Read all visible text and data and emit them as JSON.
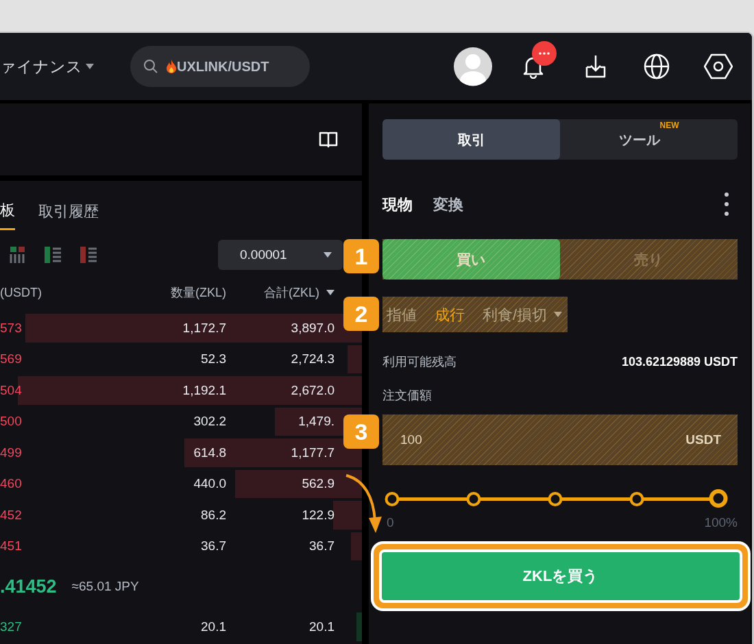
{
  "header": {
    "menu_label": "ァイナンス",
    "search": {
      "value": "UXLINK/USDT"
    }
  },
  "orderbook": {
    "tabs": [
      {
        "label": "板",
        "selected": true
      },
      {
        "label": "取引履歴",
        "selected": false
      }
    ],
    "precision": "0.00001",
    "columns": [
      "(USDT)",
      "数量(ZKL)",
      "合計(ZKL)"
    ],
    "asks": [
      {
        "price": "573",
        "amount": "1,172.7",
        "total": "3,897.0",
        "level": 0.93
      },
      {
        "price": "569",
        "amount": "52.3",
        "total": "2,724.3",
        "level": 0.04
      },
      {
        "price": "504",
        "amount": "1,192.1",
        "total": "2,672.0",
        "level": 0.95
      },
      {
        "price": "500",
        "amount": "302.2",
        "total": "1,479.",
        "level": 0.24
      },
      {
        "price": "499",
        "amount": "614.8",
        "total": "1,177.7",
        "level": 0.49
      },
      {
        "price": "460",
        "amount": "440.0",
        "total": "562.9",
        "level": 0.35
      },
      {
        "price": "452",
        "amount": "86.2",
        "total": "122.9",
        "level": 0.08
      },
      {
        "price": "451",
        "amount": "36.7",
        "total": "36.7",
        "level": 0.03
      }
    ],
    "last_price": ".41452",
    "fiat": "≈65.01 JPY",
    "bids": [
      {
        "price": "327",
        "amount": "20.1",
        "total": "20.1",
        "level": 0.015
      }
    ]
  },
  "trade": {
    "tabs": [
      {
        "label": "取引",
        "selected": true
      },
      {
        "label": "ツール",
        "badge": "NEW",
        "selected": false
      }
    ],
    "modes": [
      {
        "label": "現物",
        "selected": true
      },
      {
        "label": "変換",
        "selected": false
      }
    ],
    "side": {
      "annotation": "1",
      "options": [
        {
          "label": "買い",
          "selected": true
        },
        {
          "label": "売り",
          "selected": false
        }
      ]
    },
    "order_types": {
      "annotation": "2",
      "options": [
        {
          "label": "指値",
          "selected": false,
          "dropdown": false
        },
        {
          "label": "成行",
          "selected": true,
          "dropdown": false
        },
        {
          "label": "利食/損切",
          "selected": false,
          "dropdown": true
        }
      ]
    },
    "balance": {
      "label": "利用可能残高",
      "value": "103.62129889 USDT"
    },
    "amount": {
      "label": "注文価額",
      "value": "100",
      "unit": "USDT",
      "annotation": "3"
    },
    "slider": {
      "level": 1,
      "min_label": "0",
      "max_label": "100%"
    },
    "submit": {
      "label": "ZKLを買う",
      "highlighted": true
    }
  }
}
